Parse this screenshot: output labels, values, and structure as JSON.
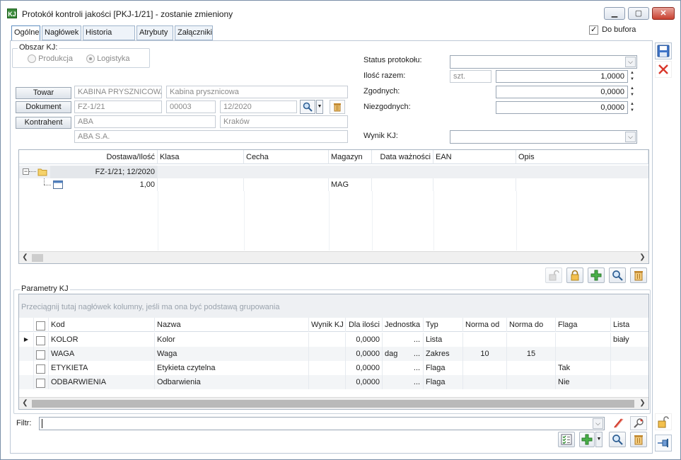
{
  "window": {
    "title": "Protokół kontroli jakości [PKJ-1/21] - zostanie zmieniony",
    "app_icon": "kj-app-icon",
    "minimize": "▁",
    "maximize": "▢",
    "close": "✕"
  },
  "tabs": [
    {
      "label": "Ogólne",
      "active": true
    },
    {
      "label": "Nagłówek"
    },
    {
      "label": "Historia zmian"
    },
    {
      "label": "Atrybuty"
    },
    {
      "label": "Załączniki"
    }
  ],
  "do_bufora": {
    "label": "Do bufora",
    "checked": true
  },
  "obszar": {
    "label": "Obszar KJ:",
    "options": [
      {
        "label": "Produkcja",
        "selected": false
      },
      {
        "label": "Logistyka",
        "selected": true
      }
    ]
  },
  "towar": {
    "button": "Towar",
    "code": "KABINA PRYSZNICOWA",
    "name": "Kabina prysznicowa"
  },
  "dokument": {
    "button": "Dokument",
    "number": "FZ-1/21",
    "seq": "00003",
    "period": "12/2020"
  },
  "kontrahent": {
    "button": "Kontrahent",
    "code": "ABA",
    "city": "Kraków",
    "name": "ABA S.A."
  },
  "status": {
    "label": "Status protokołu:",
    "value": ""
  },
  "ilosc": {
    "label": "Ilość razem:",
    "unit": "szt.",
    "value": "1,0000"
  },
  "zgodnych": {
    "label": "Zgodnych:",
    "value": "0,0000"
  },
  "niezgodnych": {
    "label": "Niezgodnych:",
    "value": "0,0000"
  },
  "wynik": {
    "label": "Wynik KJ:",
    "value": ""
  },
  "tree": {
    "columns": [
      "Dostawa/Ilość",
      "Klasa",
      "Cecha",
      "Magazyn",
      "Data ważności",
      "EAN",
      "Opis"
    ],
    "rows": [
      {
        "toggle": "−",
        "label": "FZ-1/21; 12/2020",
        "magazyn": ""
      },
      {
        "label": "1,00",
        "magazyn": "MAG"
      }
    ]
  },
  "params": {
    "label": "Parametry KJ",
    "group_hint": "Przeciągnij tutaj nagłówek kolumny, jeśli ma ona być podstawą grupowania",
    "columns": [
      "Kod",
      "Nazwa",
      "Wynik KJ",
      "Dla ilości",
      "Jednostka",
      "Typ",
      "Norma od",
      "Norma do",
      "Flaga",
      "Lista"
    ],
    "rows": [
      {
        "kod": "KOLOR",
        "nazwa": "Kolor",
        "wynik": "",
        "ilosc": "0,0000",
        "jedn": "",
        "dots": "...",
        "typ": "Lista",
        "od": "",
        "do": "",
        "flaga": "",
        "lista": "biały",
        "current": true
      },
      {
        "kod": "WAGA",
        "nazwa": "Waga",
        "wynik": "",
        "ilosc": "0,0000",
        "jedn": "dag",
        "dots": "...",
        "typ": "Zakres",
        "od": "10",
        "do": "15",
        "flaga": "",
        "lista": ""
      },
      {
        "kod": "ETYKIETA",
        "nazwa": "Etykieta czytelna",
        "wynik": "",
        "ilosc": "0,0000",
        "jedn": "",
        "dots": "...",
        "typ": "Flaga",
        "od": "",
        "do": "",
        "flaga": "Tak",
        "lista": ""
      },
      {
        "kod": "ODBARWIENIA",
        "nazwa": "Odbarwienia",
        "wynik": "",
        "ilosc": "0,0000",
        "jedn": "",
        "dots": "...",
        "typ": "Flaga",
        "od": "",
        "do": "",
        "flaga": "Nie",
        "lista": ""
      }
    ]
  },
  "filter": {
    "label": "Filtr:",
    "value": ""
  },
  "colors": {
    "accent": "#5f8ec0",
    "border": "#a9b5c2",
    "delete": "#d9372b",
    "add": "#3aa13a"
  }
}
